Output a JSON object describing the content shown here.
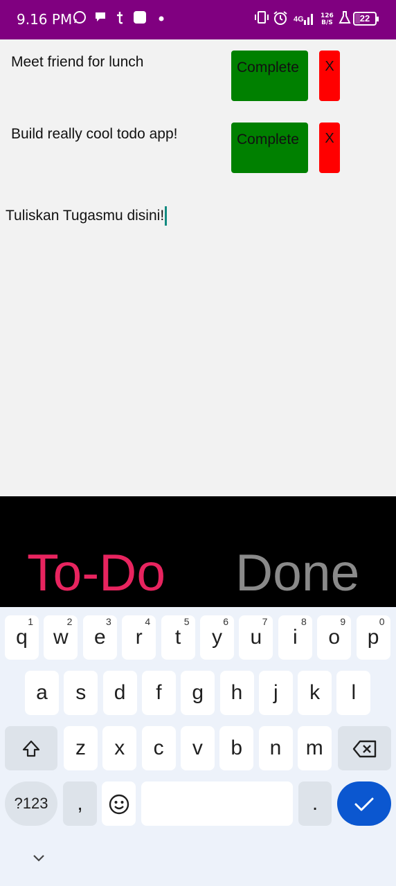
{
  "status_bar": {
    "time": "9.16 PM",
    "net_speed_value": "126",
    "net_speed_unit": "B/S",
    "network": "4G",
    "battery": "22",
    "icons": [
      "whatsapp-icon",
      "chat-icon",
      "t-app-icon",
      "square-app-icon",
      "dot-icon",
      "vibrate-icon",
      "alarm-icon",
      "signal-icon",
      "flask-icon",
      "battery-icon"
    ]
  },
  "todos": [
    {
      "text": "Meet friend for lunch",
      "complete_label": "Complete",
      "delete_label": "X"
    },
    {
      "text": "Build really cool todo app!",
      "complete_label": "Complete",
      "delete_label": "X"
    }
  ],
  "input": {
    "value": "Tuliskan Tugasmu disini!"
  },
  "tabs": {
    "todo": "To-Do",
    "done": "Done"
  },
  "colors": {
    "status_bar": "#800080",
    "complete": "#008000",
    "delete": "#ff0000",
    "tab_active": "#e8245f",
    "tab_inactive": "#8a8a8a",
    "enter_key": "#0b57d0"
  },
  "keyboard": {
    "row1": [
      {
        "k": "q",
        "h": "1"
      },
      {
        "k": "w",
        "h": "2"
      },
      {
        "k": "e",
        "h": "3"
      },
      {
        "k": "r",
        "h": "4"
      },
      {
        "k": "t",
        "h": "5"
      },
      {
        "k": "y",
        "h": "6"
      },
      {
        "k": "u",
        "h": "7"
      },
      {
        "k": "i",
        "h": "8"
      },
      {
        "k": "o",
        "h": "9"
      },
      {
        "k": "p",
        "h": "0"
      }
    ],
    "row2": [
      "a",
      "s",
      "d",
      "f",
      "g",
      "h",
      "j",
      "k",
      "l"
    ],
    "row3": [
      "z",
      "x",
      "c",
      "v",
      "b",
      "n",
      "m"
    ],
    "symbols_label": "?123",
    "comma": ",",
    "period": "."
  }
}
